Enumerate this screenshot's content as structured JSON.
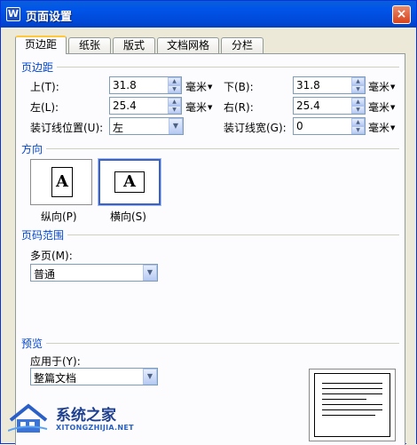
{
  "window": {
    "title": "页面设置",
    "app_icon_glyph": "W",
    "close_glyph": "×"
  },
  "tabs": [
    {
      "label": "页边距",
      "active": true
    },
    {
      "label": "纸张",
      "active": false
    },
    {
      "label": "版式",
      "active": false
    },
    {
      "label": "文档网格",
      "active": false
    },
    {
      "label": "分栏",
      "active": false
    }
  ],
  "margins": {
    "group_title": "页边距",
    "top": {
      "label": "上(T):",
      "value": "31.8",
      "unit": "毫米"
    },
    "bottom": {
      "label": "下(B):",
      "value": "31.8",
      "unit": "毫米"
    },
    "left": {
      "label": "左(L):",
      "value": "25.4",
      "unit": "毫米"
    },
    "right": {
      "label": "右(R):",
      "value": "25.4",
      "unit": "毫米"
    },
    "gutter_position": {
      "label": "装订线位置(U):",
      "value": "左"
    },
    "gutter_width": {
      "label": "装订线宽(G):",
      "value": "0",
      "unit": "毫米"
    }
  },
  "orientation": {
    "group_title": "方向",
    "portrait_label": "纵向(P)",
    "landscape_label": "横向(S)",
    "page_glyph": "A",
    "selected": "landscape"
  },
  "page_range": {
    "group_title": "页码范围",
    "multiple_label": "多页(M):",
    "multiple_value": "普通"
  },
  "preview": {
    "group_title": "预览",
    "apply_label": "应用于(Y):",
    "apply_value": "整篇文档"
  },
  "watermark": {
    "name": "系统之家",
    "url": "XITONGZHIJIA.NET"
  },
  "icons": {
    "spin_up": "▲",
    "spin_down": "▼",
    "dropdown": "▼",
    "unit_caret": "▼"
  },
  "colors": {
    "titlebar": "#0055ea",
    "dialog_bg": "#ece9d8",
    "group_title": "#0046d5",
    "tab_highlight": "#ffc83c"
  }
}
